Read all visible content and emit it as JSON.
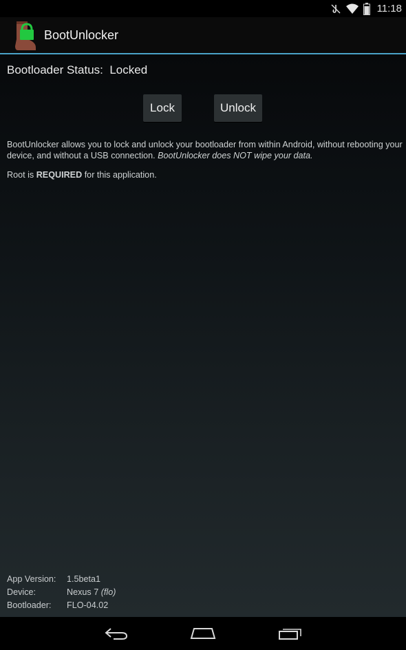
{
  "status_bar": {
    "time": "11:18",
    "icons": [
      "muted-icon",
      "wifi-icon",
      "battery-icon"
    ]
  },
  "app": {
    "title": "BootUnlocker",
    "icon": "boot-lock-icon",
    "accent": "#4aa3c8"
  },
  "main": {
    "status_label": "Bootloader Status:",
    "status_value": "Locked",
    "lock_button": "Lock",
    "unlock_button": "Unlock",
    "description": "BootUnlocker allows you to lock and unlock your bootloader from within Android, without rebooting your device, and without a USB connection.",
    "description_note": "BootUnlocker does NOT wipe your data.",
    "root_prefix": "Root is",
    "root_emphasis": "REQUIRED",
    "root_suffix": "for this application."
  },
  "info": {
    "app_version_label": "App Version:",
    "app_version_value": "1.5beta1",
    "device_label": "Device:",
    "device_value": "Nexus 7",
    "device_codename": "(flo)",
    "bootloader_label": "Bootloader:",
    "bootloader_value": "FLO-04.02"
  },
  "nav_bar": {
    "icons": [
      "back-icon",
      "home-icon",
      "recent-apps-icon"
    ]
  }
}
